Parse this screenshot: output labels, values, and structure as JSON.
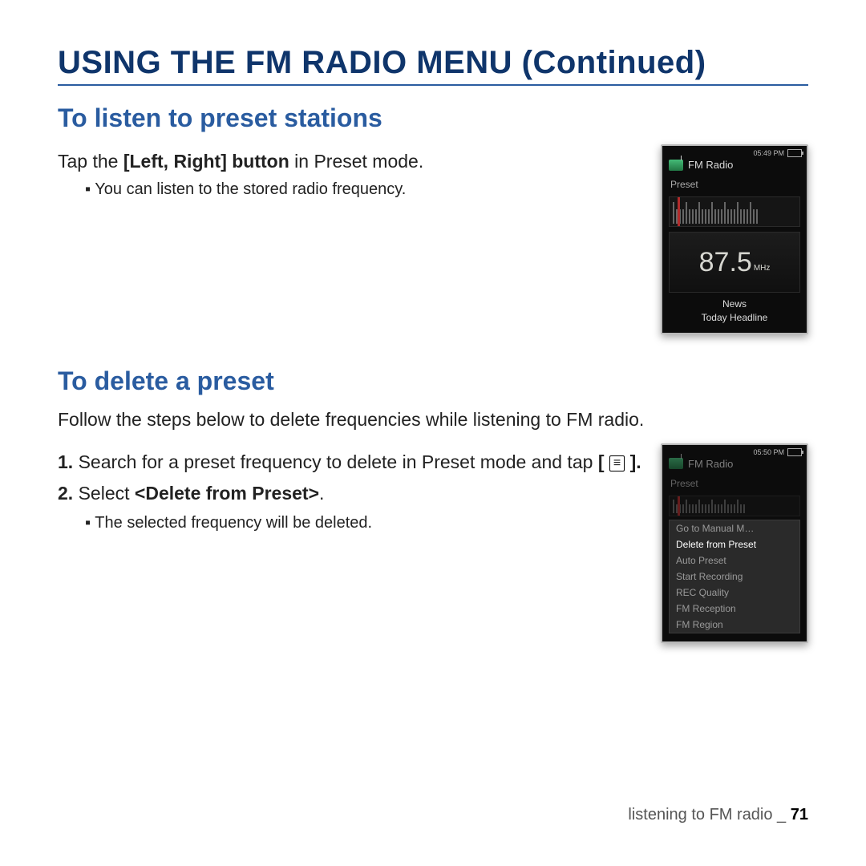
{
  "heading": "USING THE FM RADIO MENU (Continued)",
  "section1": {
    "title": "To listen to preset stations",
    "line_prefix": "Tap the ",
    "line_bold": "[Left, Right] button",
    "line_suffix": " in Preset mode.",
    "bullet": "You can listen to the stored radio frequency."
  },
  "section2": {
    "title": "To delete a preset",
    "intro": "Follow the steps below to delete frequencies while listening to FM radio.",
    "step1_num": "1.",
    "step1_prefix": " Search for a preset frequency to delete in Preset mode and tap ",
    "step1_bracket_open": "[ ",
    "step1_glyph": "≡",
    "step1_bracket_close": " ].",
    "step2_num": "2.",
    "step2_prefix": " Select ",
    "step2_bold": "<Delete from Preset>",
    "step2_suffix": ".",
    "bullet": "The selected frequency will be deleted."
  },
  "device1": {
    "time": "05:49 PM",
    "title": "FM Radio",
    "mode": "Preset",
    "freq": "87.5",
    "unit": "MHz",
    "info_line1": "News",
    "info_line2": "Today Headline"
  },
  "device2": {
    "time": "05:50 PM",
    "title": "FM Radio",
    "mode": "Preset",
    "menu": {
      "m0": "Go to Manual M…",
      "m1": "Delete from Preset",
      "m2": "Auto Preset",
      "m3": "Start Recording",
      "m4": "REC Quality",
      "m5": "FM Reception",
      "m6": "FM Region"
    }
  },
  "footer": {
    "text": "listening to FM radio _ ",
    "page": "71"
  }
}
